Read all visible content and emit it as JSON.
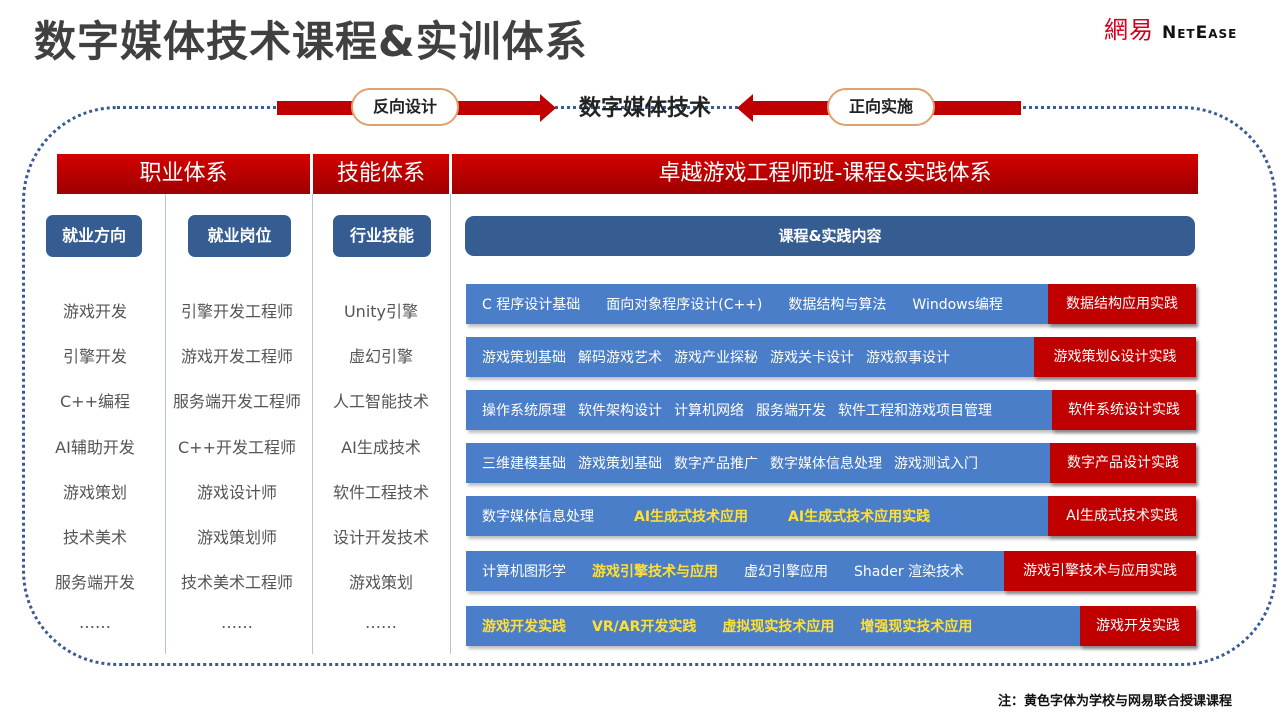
{
  "title": "数字媒体技术课程&实训体系",
  "logo": {
    "chinese": "網易",
    "english": "NetEase"
  },
  "top": {
    "left_pill": "反向设计",
    "center": "数字媒体技术",
    "right_pill": "正向实施"
  },
  "headers": {
    "career": "职业体系",
    "skills": "技能体系",
    "program": "卓越游戏工程师班-课程&实践体系"
  },
  "subheaders": {
    "direction": "就业方向",
    "position": "就业岗位",
    "industry_skill": "行业技能",
    "content": "课程&实践内容"
  },
  "directions": [
    "游戏开发",
    "引擎开发",
    "C++编程",
    "AI辅助开发",
    "游戏策划",
    "技术美术",
    "服务端开发",
    "……"
  ],
  "positions": [
    "引擎开发工程师",
    "游戏开发工程师",
    "服务端开发工程师",
    "C++开发工程师",
    "游戏设计师",
    "游戏策划师",
    "技术美术工程师",
    "……"
  ],
  "skills": [
    "Unity引擎",
    "虚幻引擎",
    "人工智能技术",
    "AI生成技术",
    "软件工程技术",
    "设计开发技术",
    "游戏策划",
    "……"
  ],
  "rows": [
    {
      "items": [
        {
          "text": "C 程序设计基础",
          "yellow": false
        },
        {
          "text": "面向对象程序设计(C++)",
          "yellow": false
        },
        {
          "text": "数据结构与算法",
          "yellow": false
        },
        {
          "text": "Windows编程",
          "yellow": false
        }
      ],
      "tag": "数据结构应用实践"
    },
    {
      "items": [
        {
          "text": "游戏策划基础",
          "yellow": false
        },
        {
          "text": "解码游戏艺术",
          "yellow": false
        },
        {
          "text": "游戏产业探秘",
          "yellow": false
        },
        {
          "text": "游戏关卡设计",
          "yellow": false
        },
        {
          "text": "游戏叙事设计",
          "yellow": false
        }
      ],
      "tag": "游戏策划&设计实践"
    },
    {
      "items": [
        {
          "text": "操作系统原理",
          "yellow": false
        },
        {
          "text": "软件架构设计",
          "yellow": false
        },
        {
          "text": "计算机网络",
          "yellow": false
        },
        {
          "text": "服务端开发",
          "yellow": false
        },
        {
          "text": "软件工程和游戏项目管理",
          "yellow": false
        }
      ],
      "tag": "软件系统设计实践"
    },
    {
      "items": [
        {
          "text": "三维建模基础",
          "yellow": false
        },
        {
          "text": "游戏策划基础",
          "yellow": false
        },
        {
          "text": "数字产品推广",
          "yellow": false
        },
        {
          "text": "数字媒体信息处理",
          "yellow": false
        },
        {
          "text": "游戏测试入门",
          "yellow": false
        }
      ],
      "tag": "数字产品设计实践"
    },
    {
      "items": [
        {
          "text": "数字媒体信息处理",
          "yellow": false
        },
        {
          "text": "AI生成式技术应用",
          "yellow": true
        },
        {
          "text": "AI生成式技术应用实践",
          "yellow": true
        }
      ],
      "tag": "AI生成式技术实践"
    },
    {
      "items": [
        {
          "text": "计算机图形学",
          "yellow": false
        },
        {
          "text": "游戏引擎技术与应用",
          "yellow": true
        },
        {
          "text": "虚幻引擎应用",
          "yellow": false
        },
        {
          "text": "Shader 渲染技术",
          "yellow": false
        }
      ],
      "tag": "游戏引擎技术与应用实践"
    },
    {
      "items": [
        {
          "text": "游戏开发实践",
          "yellow": true
        },
        {
          "text": "VR/AR开发实践",
          "yellow": true
        },
        {
          "text": "虚拟现实技术应用",
          "yellow": true
        },
        {
          "text": "增强现实技术应用",
          "yellow": true
        }
      ],
      "tag": "游戏开发实践"
    }
  ],
  "note": "注：黄色字体为学校与网易联合授课课程",
  "colors": {
    "red": "#c00000",
    "navy": "#365d92",
    "row_blue": "#4a7ec8",
    "highlight_yellow": "#ffe033"
  }
}
